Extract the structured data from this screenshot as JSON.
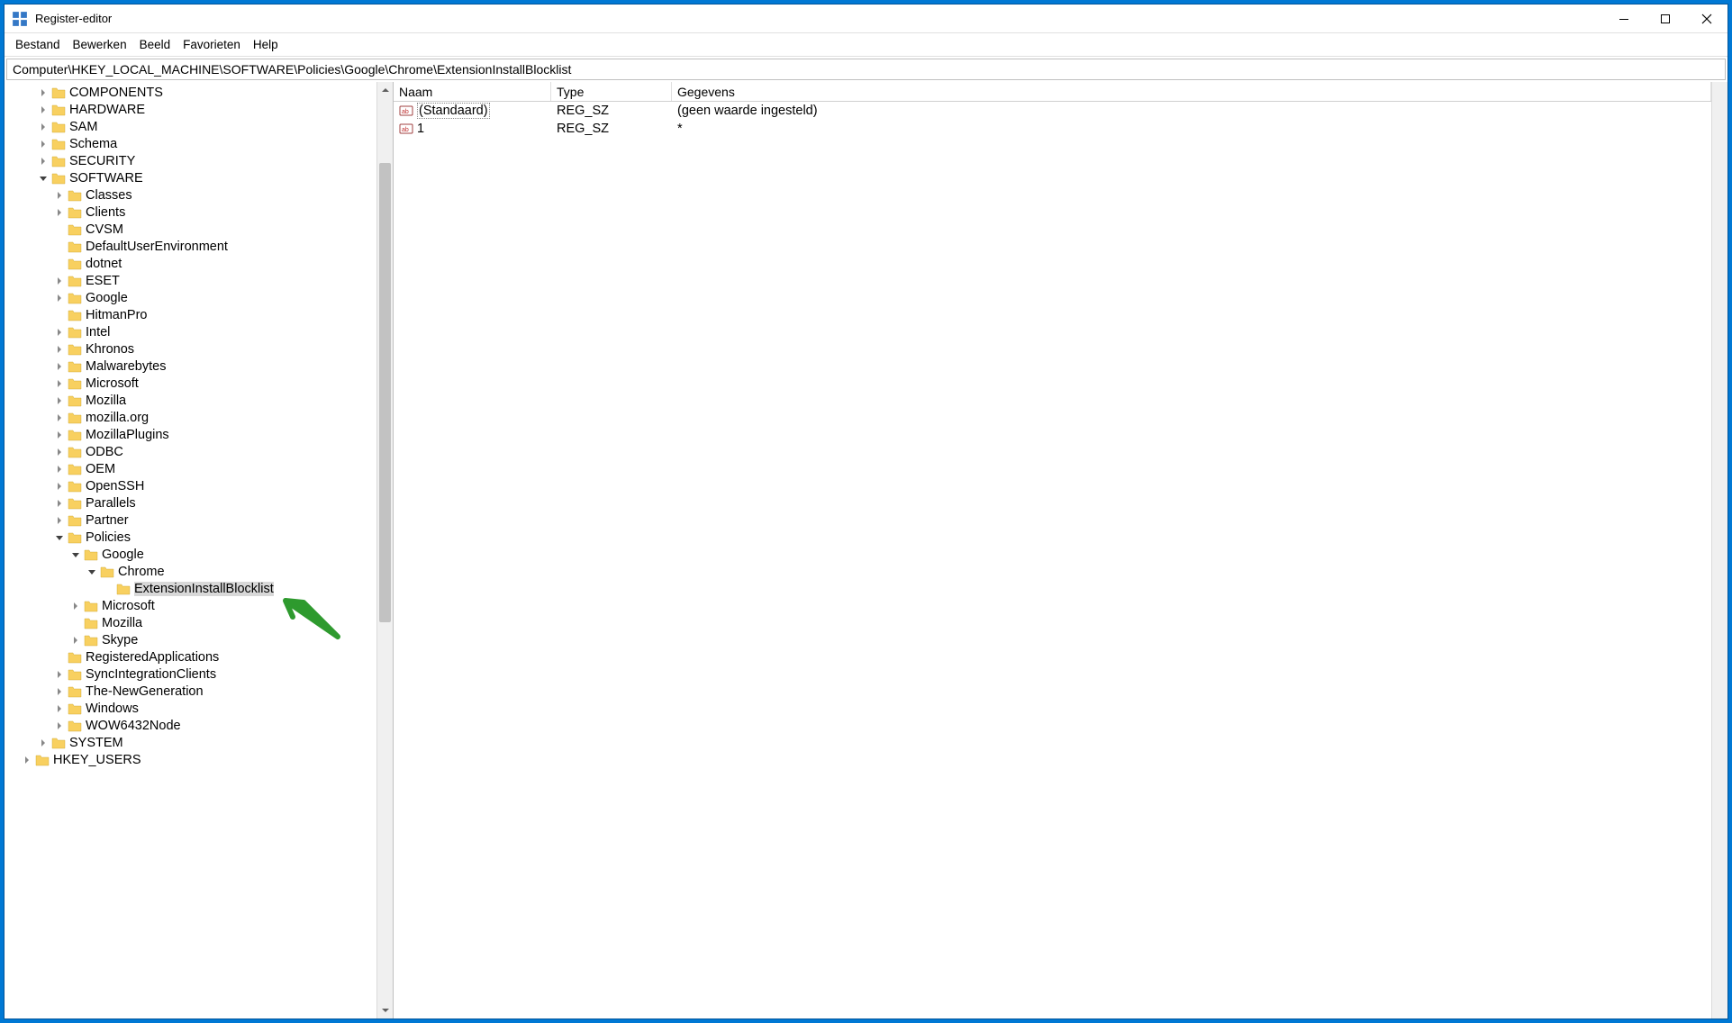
{
  "window": {
    "title": "Register-editor"
  },
  "menu": {
    "file": "Bestand",
    "edit": "Bewerken",
    "view": "Beeld",
    "favorites": "Favorieten",
    "help": "Help"
  },
  "address": "Computer\\HKEY_LOCAL_MACHINE\\SOFTWARE\\Policies\\Google\\Chrome\\ExtensionInstallBlocklist",
  "tree": {
    "components": "COMPONENTS",
    "hardware": "HARDWARE",
    "sam": "SAM",
    "schema": "Schema",
    "security": "SECURITY",
    "software": "SOFTWARE",
    "classes": "Classes",
    "clients": "Clients",
    "cvsm": "CVSM",
    "defaultuserenv": "DefaultUserEnvironment",
    "dotnet": "dotnet",
    "eset": "ESET",
    "google_sw": "Google",
    "hitmanpro": "HitmanPro",
    "intel": "Intel",
    "khronos": "Khronos",
    "malwarebytes": "Malwarebytes",
    "microsoft_sw": "Microsoft",
    "mozilla_sw": "Mozilla",
    "mozillaorg": "mozilla.org",
    "mozillaplugins": "MozillaPlugins",
    "odbc": "ODBC",
    "oem": "OEM",
    "openssh": "OpenSSH",
    "parallels": "Parallels",
    "partner": "Partner",
    "policies": "Policies",
    "google_pol": "Google",
    "chrome": "Chrome",
    "extblocklist": "ExtensionInstallBlocklist",
    "microsoft_pol": "Microsoft",
    "mozilla_pol": "Mozilla",
    "skype": "Skype",
    "registeredapps": "RegisteredApplications",
    "syncintegration": "SyncIntegrationClients",
    "thenewgen": "The-NewGeneration",
    "windows": "Windows",
    "wow64": "WOW6432Node",
    "system": "SYSTEM",
    "hkeyusers": "HKEY_USERS"
  },
  "values": {
    "header": {
      "name": "Naam",
      "type": "Type",
      "data": "Gegevens"
    },
    "rows": [
      {
        "name": "(Standaard)",
        "type": "REG_SZ",
        "data": "(geen waarde ingesteld)",
        "default": true
      },
      {
        "name": "1",
        "type": "REG_SZ",
        "data": "*",
        "default": false
      }
    ]
  }
}
